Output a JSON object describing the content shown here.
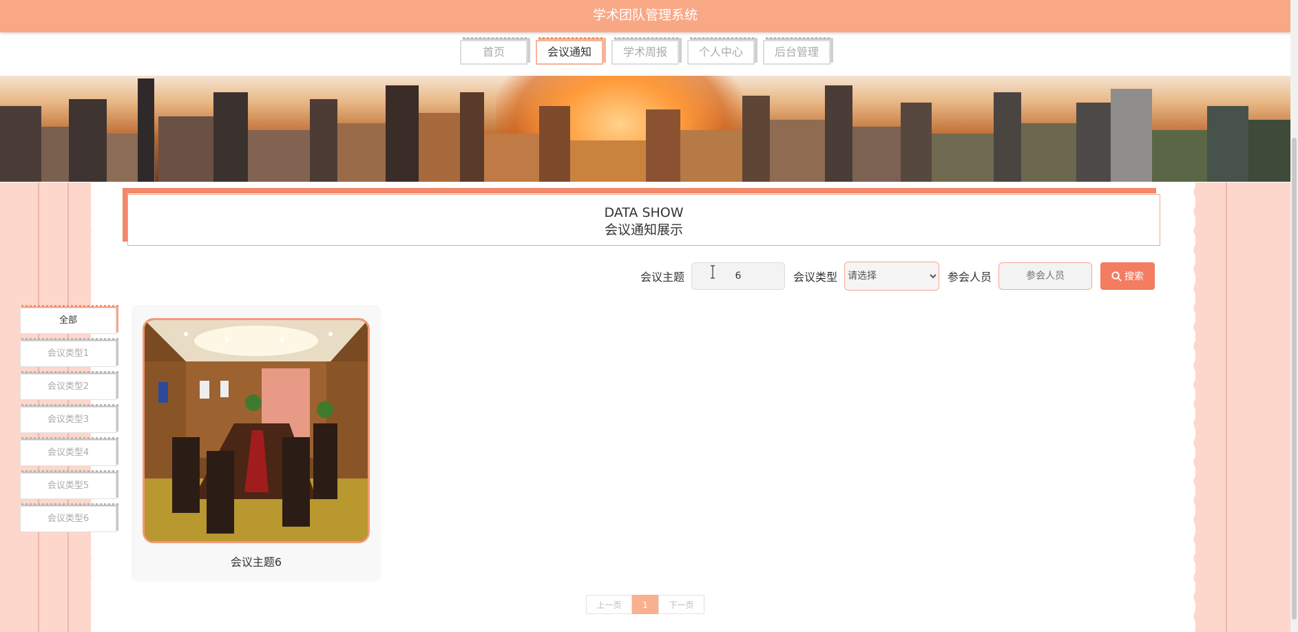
{
  "app": {
    "title": "学术团队管理系统"
  },
  "nav": {
    "items": [
      {
        "label": "首页",
        "active": false
      },
      {
        "label": "会议通知",
        "active": true
      },
      {
        "label": "学术周报",
        "active": false
      },
      {
        "label": "个人中心",
        "active": false
      },
      {
        "label": "后台管理",
        "active": false
      }
    ]
  },
  "section": {
    "title_en": "DATA SHOW",
    "title_cn": "会议通知展示"
  },
  "search": {
    "topic_label": "会议主题",
    "topic_value": "6",
    "type_label": "会议类型",
    "type_selected": "请选择",
    "people_label": "参会人员",
    "people_placeholder": "参会人员",
    "button_label": "搜索"
  },
  "categories": [
    {
      "label": "全部",
      "active": true
    },
    {
      "label": "会议类型1",
      "active": false
    },
    {
      "label": "会议类型2",
      "active": false
    },
    {
      "label": "会议类型3",
      "active": false
    },
    {
      "label": "会议类型4",
      "active": false
    },
    {
      "label": "会议类型5",
      "active": false
    },
    {
      "label": "会议类型6",
      "active": false
    }
  ],
  "cards": [
    {
      "title": "会议主题6",
      "image": "meeting-room"
    }
  ],
  "pagination": {
    "prev": "上一页",
    "current": "1",
    "next": "下一页"
  },
  "colors": {
    "accent": "#f37c61",
    "header": "#f9a886",
    "side": "#fdd7cb"
  }
}
